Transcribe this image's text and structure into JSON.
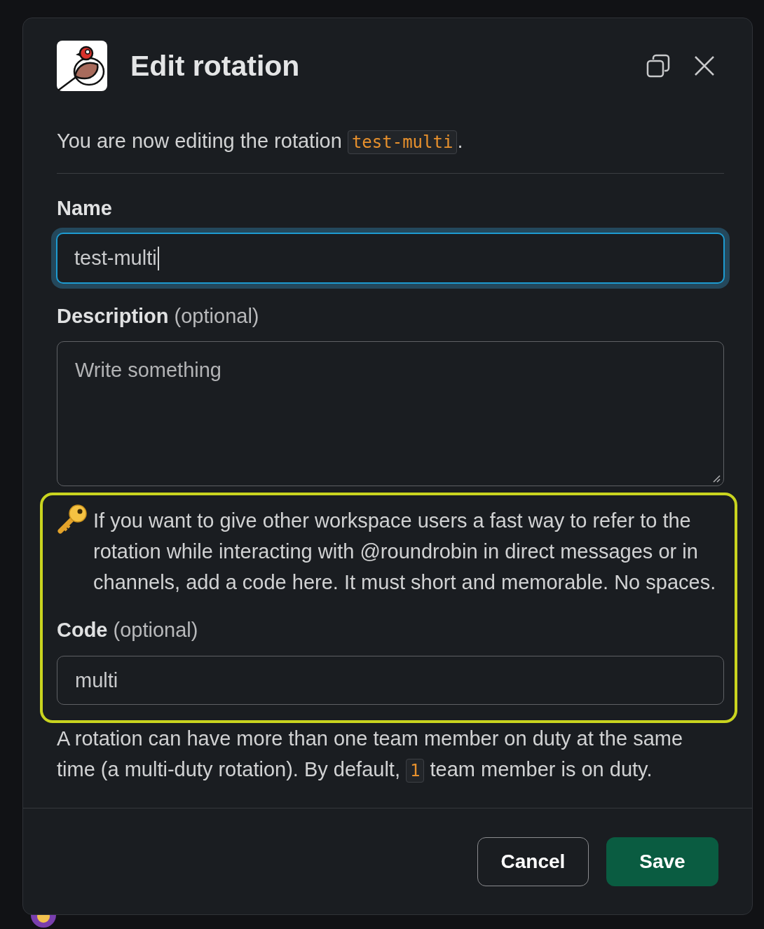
{
  "modal": {
    "title": "Edit rotation",
    "intro": {
      "before": "You are now editing the rotation",
      "code": "test-multi",
      "after": "."
    },
    "name_field": {
      "label": "Name",
      "value": "test-multi",
      "focused": true
    },
    "description_field": {
      "label": "Description",
      "hint": "(optional)",
      "placeholder": "Write something"
    },
    "code_section": {
      "highlighted": true,
      "note": "If you want to give other workspace users a fast way to refer to the rotation while interacting with @roundrobin in direct messages or in channels, add a code here. It must short and memorable. No spaces.",
      "label": "Code",
      "hint": "(optional)",
      "value": "multi"
    },
    "duty_note": {
      "before": "A rotation can have more than one team member on duty at the same time (a multi-duty rotation). By default,",
      "code": "1",
      "after": "team member is on duty."
    },
    "buttons": [
      {
        "label": "Cancel",
        "kind": "secondary"
      },
      {
        "label": "Save",
        "kind": "primary"
      }
    ]
  }
}
